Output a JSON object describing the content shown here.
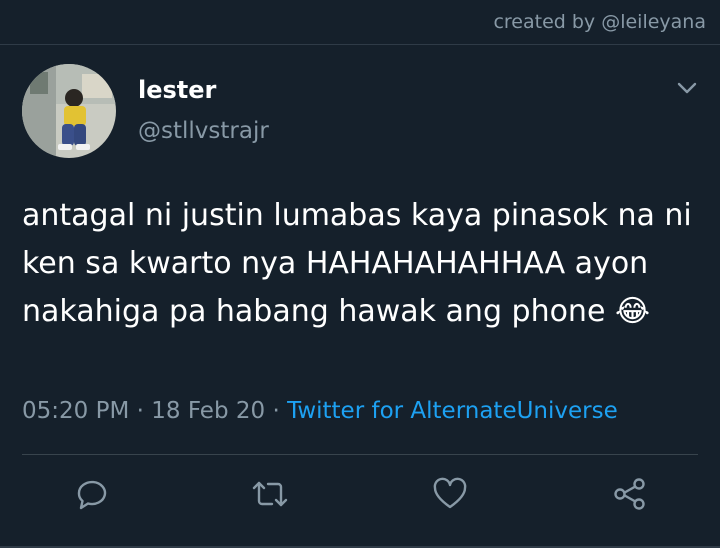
{
  "watermark": "created by @leileyana",
  "user": {
    "display_name": "lester",
    "handle": "@stllvstrajr"
  },
  "tweet": {
    "text": "antagal ni justin lumabas kaya pinasok na ni ken sa kwarto nya HAHAHAHAHHAA ayon nakahiga pa habang hawak ang phone",
    "emoji": "😂",
    "time": "05:20 PM",
    "separator": "·",
    "date": "18 Feb 20",
    "source": "Twitter for AlternateUniverse"
  },
  "icons": {
    "menu": "chevron-down-icon",
    "reply": "reply-icon",
    "retweet": "retweet-icon",
    "like": "heart-icon",
    "share": "share-icon"
  },
  "colors": {
    "background": "#15202b",
    "secondary_text": "#8899a6",
    "link": "#1da1f2"
  }
}
